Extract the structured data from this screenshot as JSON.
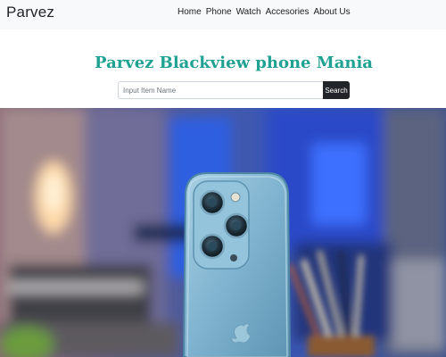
{
  "navbar": {
    "brand": "Parvez",
    "links": [
      "Home",
      "Phone",
      "Watch",
      "Accesories",
      "About Us"
    ]
  },
  "headline": "Parvez Blackview phone Mania",
  "search": {
    "placeholder": "Input Item Name",
    "value": "",
    "button_label": "Search"
  },
  "hero": {
    "image_subject": "blue-smartphone-back-with-triple-camera-photo"
  },
  "colors": {
    "headline": "#20a293",
    "navbar_bg": "#f8f9fa",
    "search_button_bg": "#212529"
  }
}
